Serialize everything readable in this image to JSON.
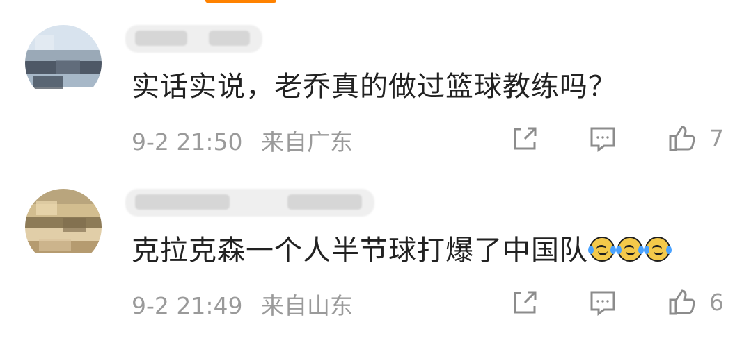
{
  "comments": [
    {
      "text": "实话实说，老乔真的做过篮球教练吗？",
      "time": "9-2 21:50",
      "location": "来自广东",
      "likes": "7"
    },
    {
      "text": "克拉克森一个人半节球打爆了中国队",
      "time": "9-2 21:49",
      "location": "来自山东",
      "likes": "6",
      "emoji_icons": [
        "laughing-tears-icon",
        "laughing-tears-icon",
        "laughing-tears-icon"
      ]
    }
  ],
  "colors": {
    "accent": "#ff8200",
    "primary_text": "#222222",
    "secondary_text": "#9a9a9a",
    "icon_gray": "#8c8c8c"
  },
  "icons": {
    "share": "share-icon",
    "reply": "comment-icon",
    "like": "thumbs-up-icon"
  }
}
